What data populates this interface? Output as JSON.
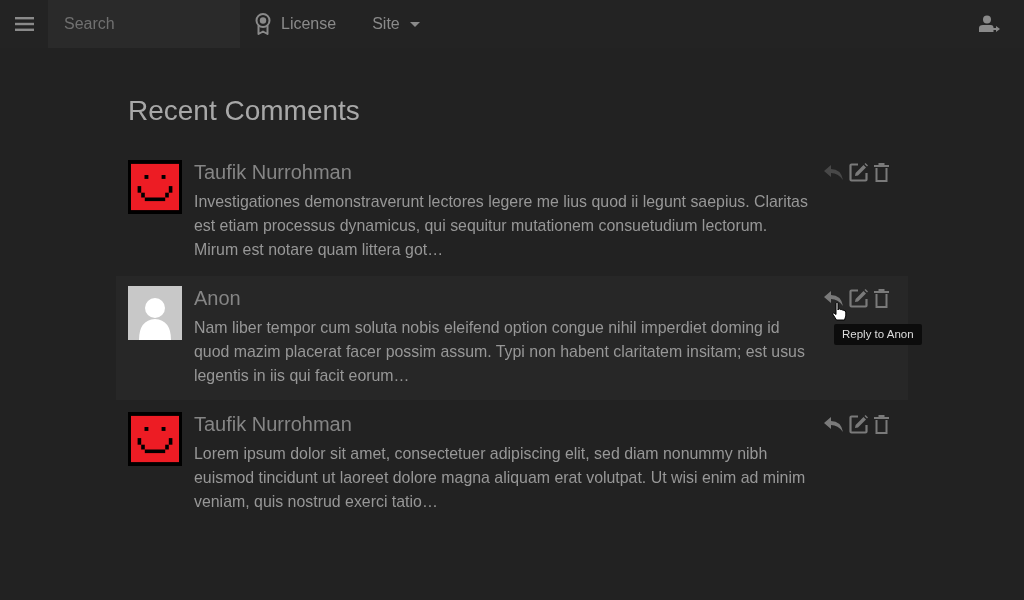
{
  "navbar": {
    "search": {
      "placeholder": "Search"
    },
    "links": [
      {
        "label": "License",
        "kind": "icon-link"
      },
      {
        "label": "Site",
        "kind": "dropdown"
      }
    ]
  },
  "page": {
    "title": "Recent Comments"
  },
  "comments": [
    {
      "author": "Taufik Nurrohman",
      "kind": "identicon",
      "text": "Investigationes demonstraverunt lectores legere me lius quod ii legunt saepius. Claritas est etiam processus dynamicus, qui sequitur mutationem consuetudium lectorum. Mirum est notare quam littera got…",
      "hovered": false,
      "reply_disabled": true
    },
    {
      "author": "Anon",
      "kind": "default",
      "text": "Nam liber tempor cum soluta nobis eleifend option congue nihil imperdiet doming id quod mazim placerat facer possim assum. Typi non habent claritatem insitam; est usus legentis in iis qui facit eorum…",
      "hovered": true,
      "reply_disabled": false,
      "tooltip": "Reply to Anon"
    },
    {
      "author": "Taufik Nurrohman",
      "kind": "identicon",
      "text": "Lorem ipsum dolor sit amet, consectetuer adipiscing elit, sed diam nonummy nibh euismod tincidunt ut laoreet dolore magna aliquam erat volutpat. Ut wisi enim ad minim veniam, quis nostrud exerci tatio…",
      "hovered": false,
      "reply_disabled": false
    }
  ]
}
